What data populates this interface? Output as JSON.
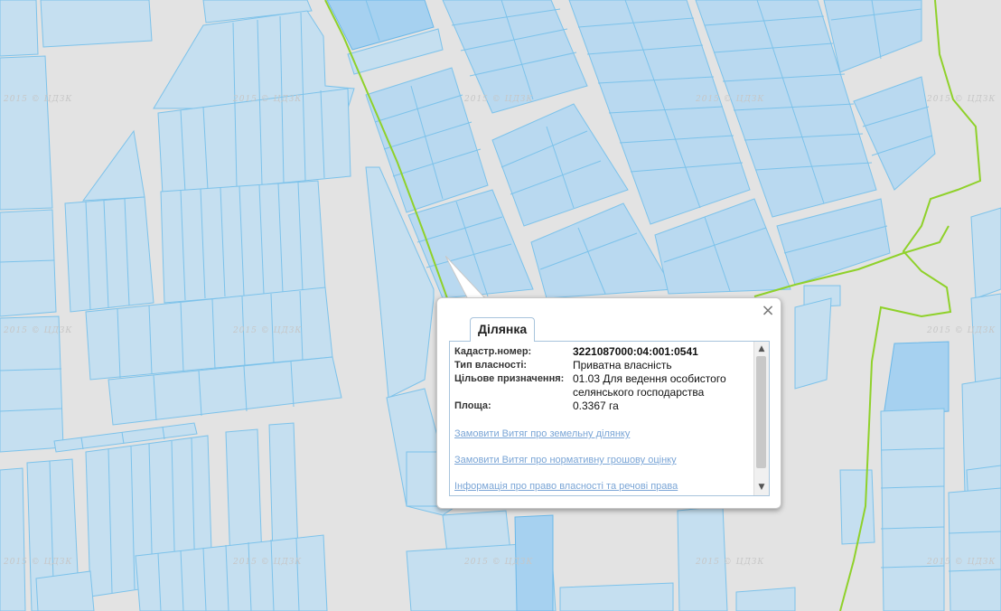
{
  "map": {
    "watermark_text": "2015 © ЦДЗК",
    "colors": {
      "background": "#e3e3e3",
      "parcel_fill": "#b9d9f0",
      "parcel_stroke": "#7cc2ea",
      "boundary": "#8fd12a"
    }
  },
  "popup": {
    "close_symbol": "×",
    "close_icon": "close-icon",
    "tab_label": "Ділянка",
    "fields": [
      {
        "label": "Кадастр.номер:",
        "value": "3221087000:04:001:0541"
      },
      {
        "label": "Тип власності:",
        "value": "Приватна власність"
      },
      {
        "label": "Цільове призначення:",
        "value": "01.03 Для ведення особистого селянського господарства"
      },
      {
        "label": "Площа:",
        "value": "0.3367 га"
      }
    ],
    "links": [
      "Замовити Витяг про земельну ділянку",
      "Замовити Витяг про нормативну грошову оцінку",
      "Інформація про право власності та речові права"
    ]
  }
}
